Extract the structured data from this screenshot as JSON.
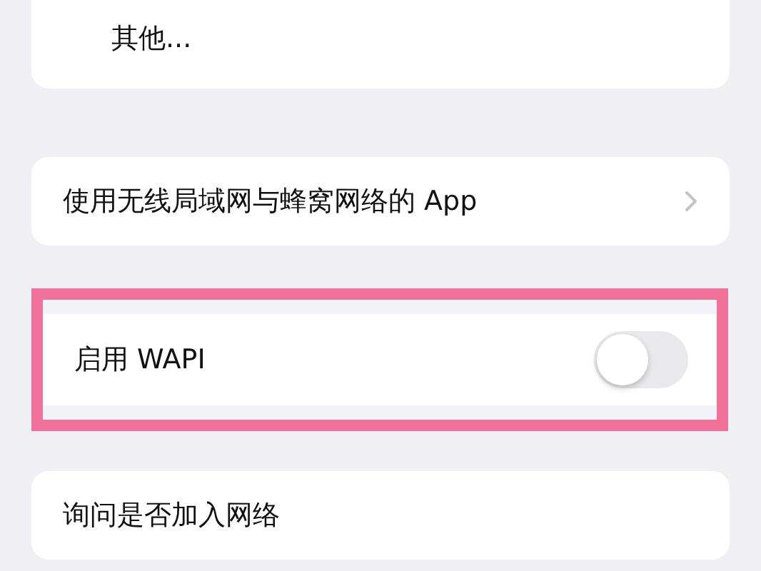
{
  "sections": [
    {
      "highlighted": false,
      "rows": [
        {
          "kind": "option",
          "label": "其他..."
        }
      ]
    },
    {
      "highlighted": false,
      "rows": [
        {
          "kind": "link",
          "label": "使用无线局域网与蜂窝网络的 App"
        }
      ]
    },
    {
      "highlighted": true,
      "rows": [
        {
          "kind": "toggle",
          "label": "启用 WAPI",
          "on": false
        }
      ]
    },
    {
      "highlighted": false,
      "rows": [
        {
          "kind": "text",
          "label": "询问是否加入网络"
        }
      ]
    }
  ]
}
